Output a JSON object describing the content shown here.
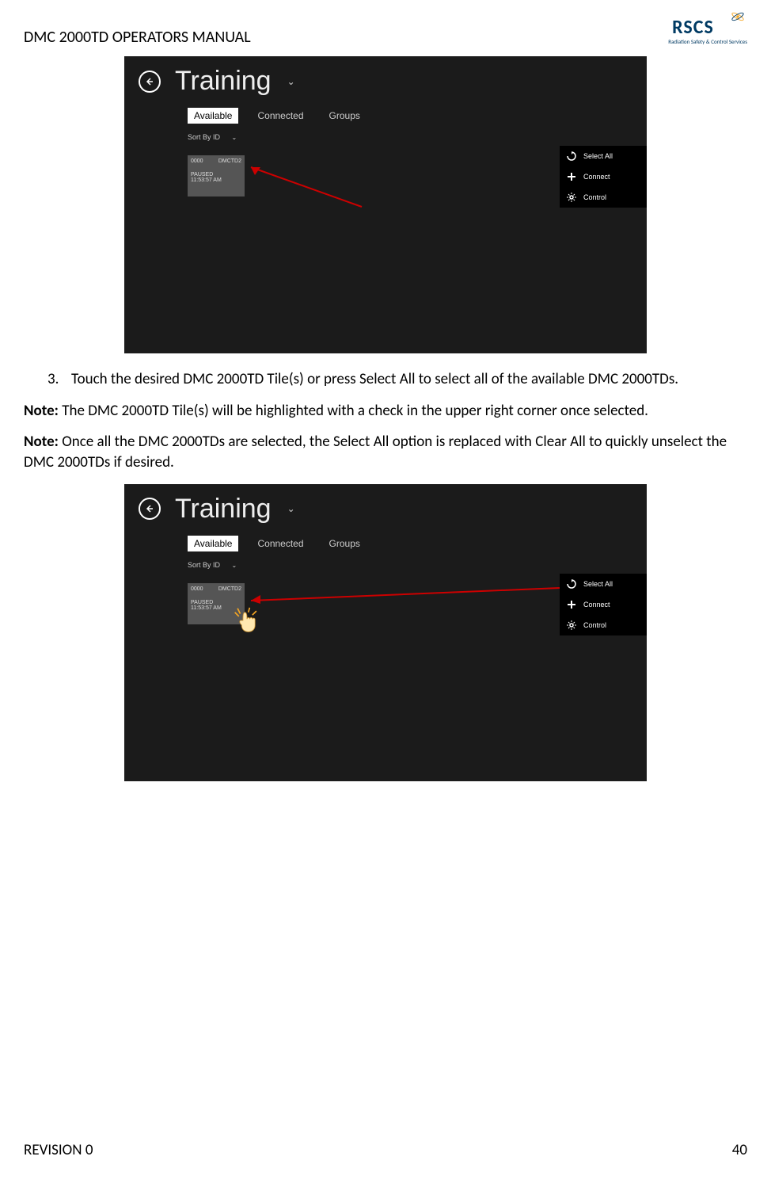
{
  "header": {
    "title": "DMC 2000TD OPERATORS MANUAL",
    "logo_text": "RSCS",
    "logo_sub": "Radiation Safety & Control Services"
  },
  "screenshot": {
    "title": "Training",
    "tabs": {
      "available": "Available",
      "connected": "Connected",
      "groups": "Groups"
    },
    "sort_label": "Sort By ID",
    "tile": {
      "id": "0000",
      "model": "DMCTD2",
      "status": "PAUSED",
      "time": "11:53:57 AM"
    },
    "side": {
      "select_all": "Select All",
      "connect": "Connect",
      "control": "Control"
    }
  },
  "steps": {
    "num3": "3.",
    "text3": "Touch the desired DMC 2000TD Tile(s) or press Select All to select all of the available DMC 2000TDs."
  },
  "notes": {
    "label": "Note:",
    "n1": " The DMC 2000TD Tile(s) will be highlighted with a check in the upper right corner once selected.",
    "n2": " Once all the DMC 2000TDs are selected, the Select All option is replaced with Clear All to quickly unselect the DMC 2000TDs if desired."
  },
  "footer": {
    "revision": "REVISION 0",
    "page": "40"
  }
}
